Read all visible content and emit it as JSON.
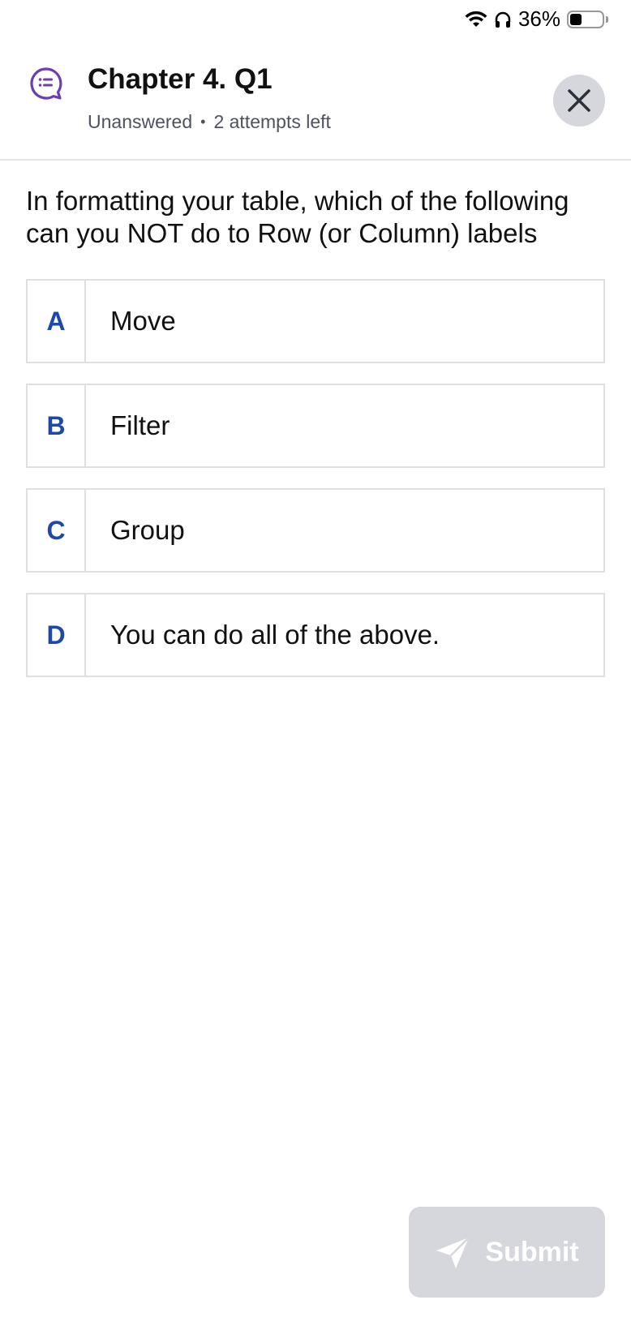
{
  "status_bar": {
    "battery_percent": "36%",
    "battery_level": 0.36
  },
  "header": {
    "title": "Chapter 4. Q1",
    "status": "Unanswered",
    "separator": "•",
    "attempts": "2 attempts left",
    "icon": "discussion-bubble-icon",
    "close_icon": "close-icon"
  },
  "question": {
    "text": "In formatting your table, which of the following can you NOT do to Row (or Column) labels"
  },
  "options": [
    {
      "letter": "A",
      "text": "Move"
    },
    {
      "letter": "B",
      "text": "Filter"
    },
    {
      "letter": "C",
      "text": "Group"
    },
    {
      "letter": "D",
      "text": "You can do all of the above."
    }
  ],
  "submit": {
    "label": "Submit",
    "icon": "send-icon"
  },
  "colors": {
    "accent": "#1d4aa8",
    "icon_purple": "#6b3fb3",
    "disabled_bg": "#d5d7dc"
  }
}
